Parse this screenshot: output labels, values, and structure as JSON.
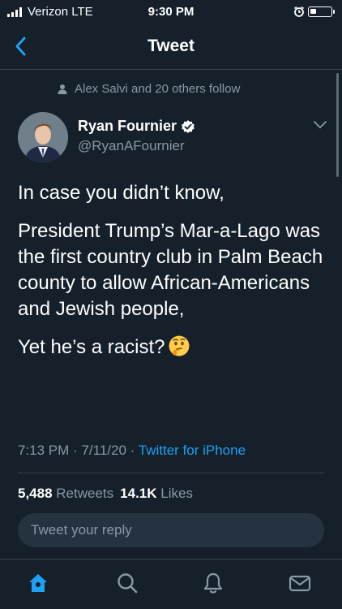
{
  "status_bar": {
    "carrier": "Verizon  LTE",
    "time": "9:30 PM",
    "signal_bars": 4,
    "battery_level": 0.2
  },
  "nav": {
    "title": "Tweet",
    "back_icon": "chevron-left-icon"
  },
  "social_context": {
    "text": "Alex Salvi and 20 others follow"
  },
  "author": {
    "display_name": "Ryan Fournier",
    "handle": "@RyanAFournier",
    "verified": true
  },
  "tweet": {
    "paragraphs": [
      "In case you didn’t know,",
      "President Trump’s Mar-a-Lago was the first country club in Palm Beach county to allow African-Americans and Jewish people,",
      "Yet he’s a racist?"
    ],
    "trailing_emoji": "thinking-face"
  },
  "meta": {
    "time": "7:13 PM",
    "date": "7/11/20",
    "source": "Twitter for iPhone",
    "sep": "·"
  },
  "stats": {
    "retweets_count": "5,488",
    "retweets_label": "Retweets",
    "likes_count": "14.1K",
    "likes_label": "Likes"
  },
  "reply": {
    "placeholder": "Tweet your reply"
  },
  "tab_bar": {
    "tabs": [
      "home-icon",
      "search-icon",
      "notifications-icon",
      "messages-icon"
    ],
    "active_tab": "home-icon"
  },
  "colors": {
    "background": "#15202b",
    "accent": "#1da1f2",
    "secondary_text": "#8899a6",
    "divider": "#38444d"
  }
}
